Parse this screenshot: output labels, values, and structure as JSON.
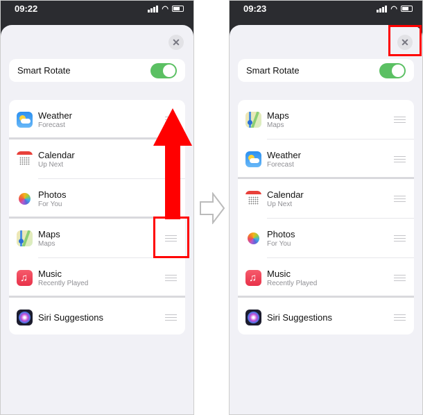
{
  "accent": "#ff0000",
  "panels": [
    {
      "time": "09:22",
      "smart_rotate_label": "Smart Rotate",
      "smart_rotate_on": true,
      "close_icon": "close-icon",
      "widgets": [
        {
          "title": "Weather",
          "subtitle": "Forecast",
          "icon": "weather-icon"
        },
        {
          "title": "Calendar",
          "subtitle": "Up Next",
          "icon": "calendar-icon"
        },
        {
          "title": "Photos",
          "subtitle": "For You",
          "icon": "photos-icon"
        },
        {
          "title": "Maps",
          "subtitle": "Maps",
          "icon": "maps-icon"
        },
        {
          "title": "Music",
          "subtitle": "Recently Played",
          "icon": "music-icon"
        },
        {
          "title": "Siri Suggestions",
          "subtitle": "",
          "icon": "siri-icon"
        }
      ]
    },
    {
      "time": "09:23",
      "smart_rotate_label": "Smart Rotate",
      "smart_rotate_on": true,
      "close_icon": "close-icon",
      "widgets": [
        {
          "title": "Maps",
          "subtitle": "Maps",
          "icon": "maps-icon"
        },
        {
          "title": "Weather",
          "subtitle": "Forecast",
          "icon": "weather-icon"
        },
        {
          "title": "Calendar",
          "subtitle": "Up Next",
          "icon": "calendar-icon"
        },
        {
          "title": "Photos",
          "subtitle": "For You",
          "icon": "photos-icon"
        },
        {
          "title": "Music",
          "subtitle": "Recently Played",
          "icon": "music-icon"
        },
        {
          "title": "Siri Suggestions",
          "subtitle": "",
          "icon": "siri-icon"
        }
      ]
    }
  ]
}
